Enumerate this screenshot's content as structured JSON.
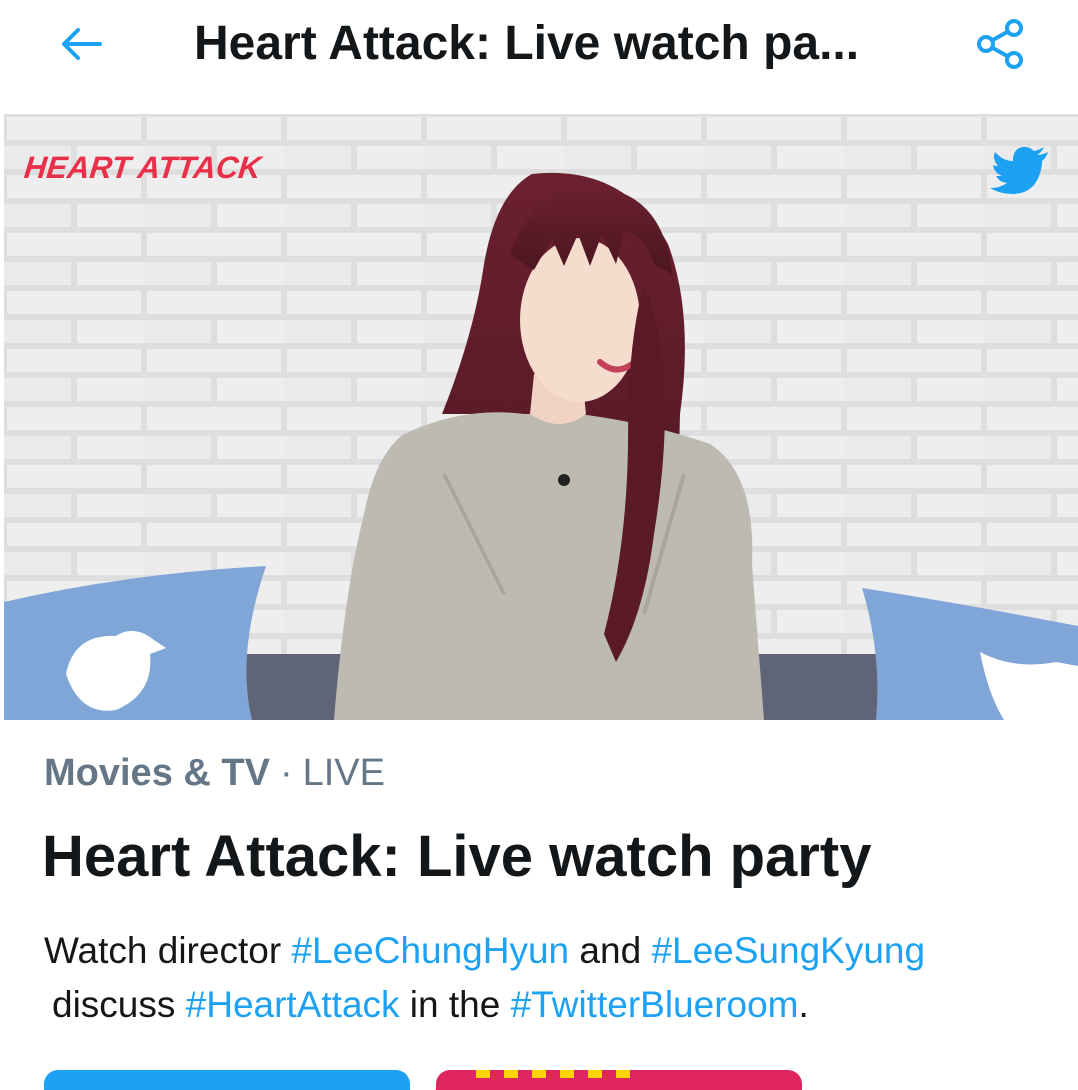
{
  "header": {
    "title": "Heart Attack: Live watch pa...",
    "back_icon": "arrow-left-icon",
    "share_icon": "share-icon",
    "accent": "#1da1f2"
  },
  "media": {
    "show_logo_text": "HEART ATTACK",
    "brand_icon": "twitter-bird-icon",
    "logo_color": "#e8304a"
  },
  "event": {
    "category": "Movies & TV",
    "separator": "·",
    "status": "LIVE",
    "title": "Heart Attack: Live watch party"
  },
  "description": {
    "w1": "Watch director ",
    "h1": "#LeeChungHyun",
    "w2": " and ",
    "h2": "#LeeSungKyung",
    "w3": "discuss ",
    "h3": "#HeartAttack",
    "w4": " in the ",
    "h4": "#TwitterBlueroom",
    "w5": "."
  },
  "colors": {
    "hashtag": "#1da1f2",
    "muted": "#657786",
    "text": "#14171a"
  }
}
